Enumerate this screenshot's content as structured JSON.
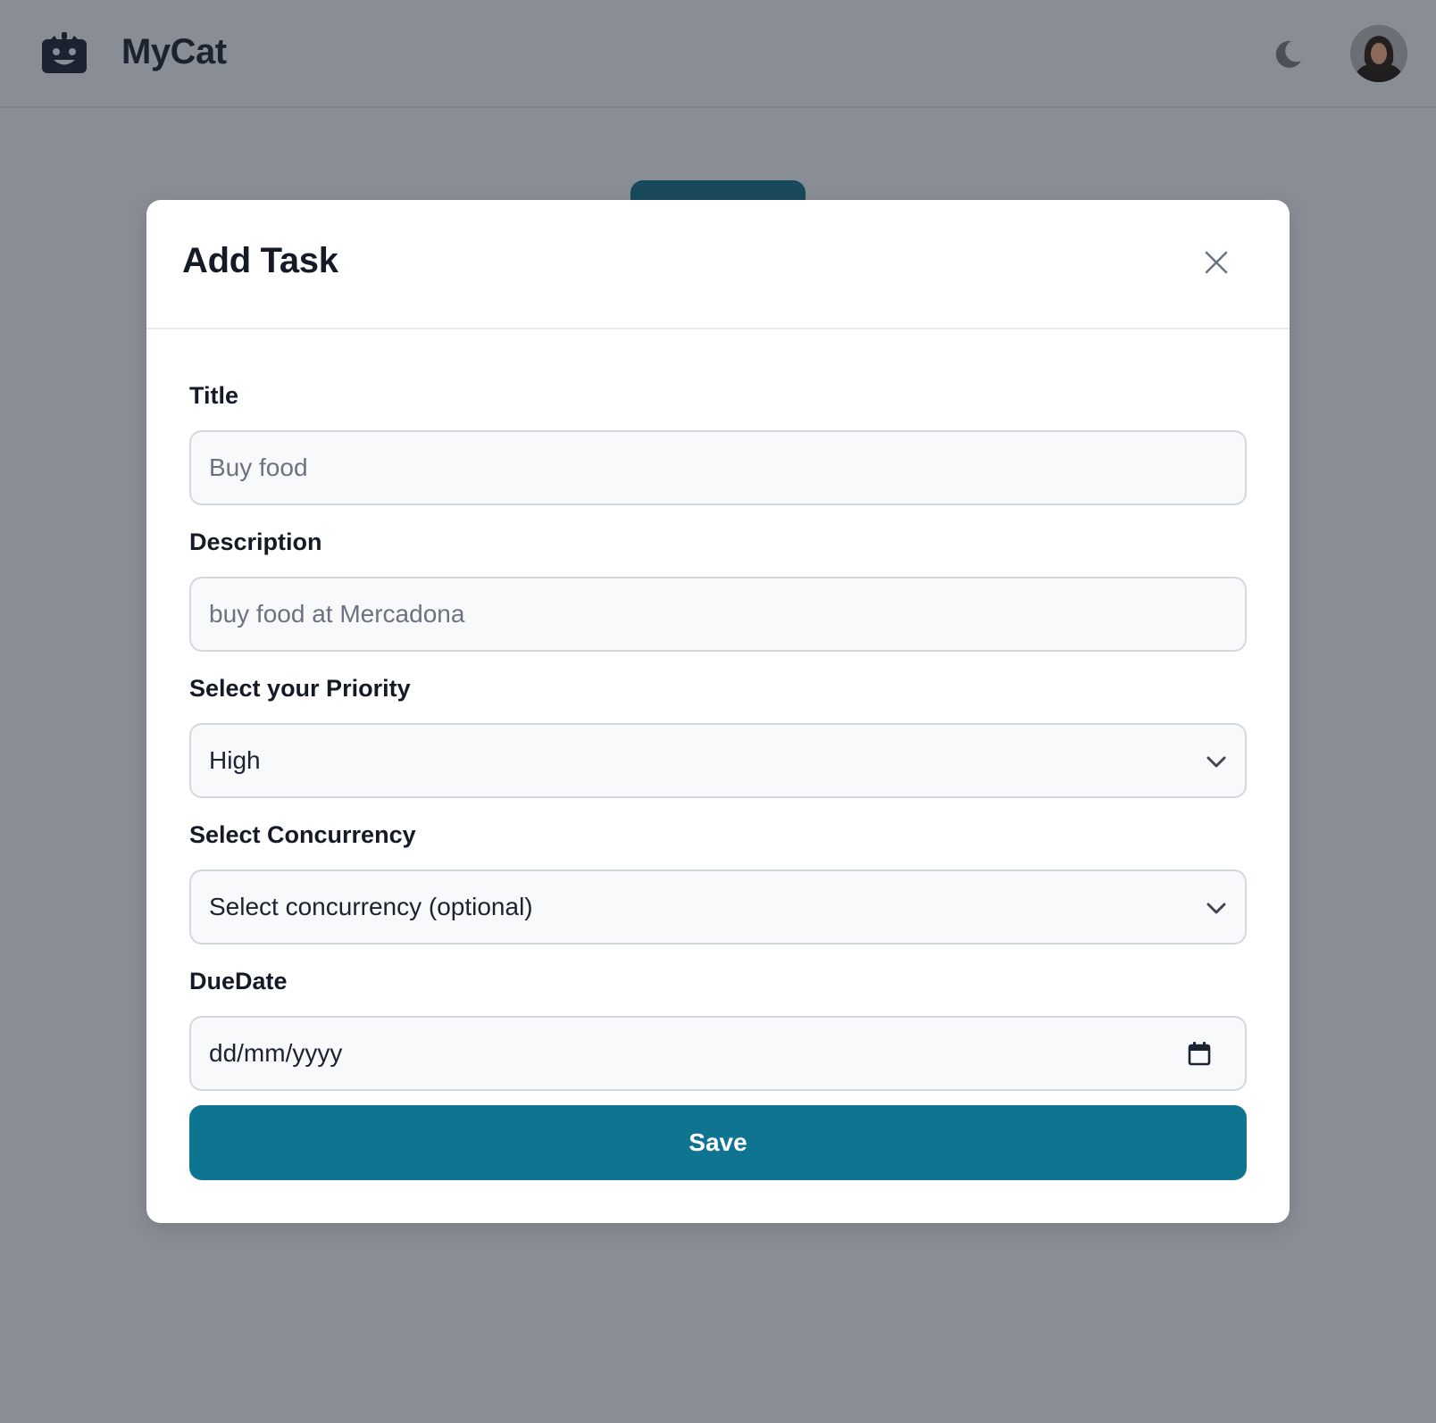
{
  "header": {
    "app_name": "MyCat",
    "logo_icon": "robot-icon",
    "theme_icon": "moon-icon"
  },
  "modal": {
    "title": "Add Task",
    "close_icon": "close-icon",
    "fields": {
      "title": {
        "label": "Title",
        "placeholder": "Buy food"
      },
      "description": {
        "label": "Description",
        "placeholder": "buy food at Mercadona"
      },
      "priority": {
        "label": "Select your Priority",
        "value": "High"
      },
      "concurrency": {
        "label": "Select Concurrency",
        "value": "Select concurrency (optional)"
      },
      "due_date": {
        "label": "DueDate",
        "value": "dd/mm/yyyy"
      }
    },
    "save_label": "Save"
  },
  "colors": {
    "overlay_bg": "#898d95",
    "primary": "#0e7490",
    "modal_bg": "#ffffff"
  }
}
